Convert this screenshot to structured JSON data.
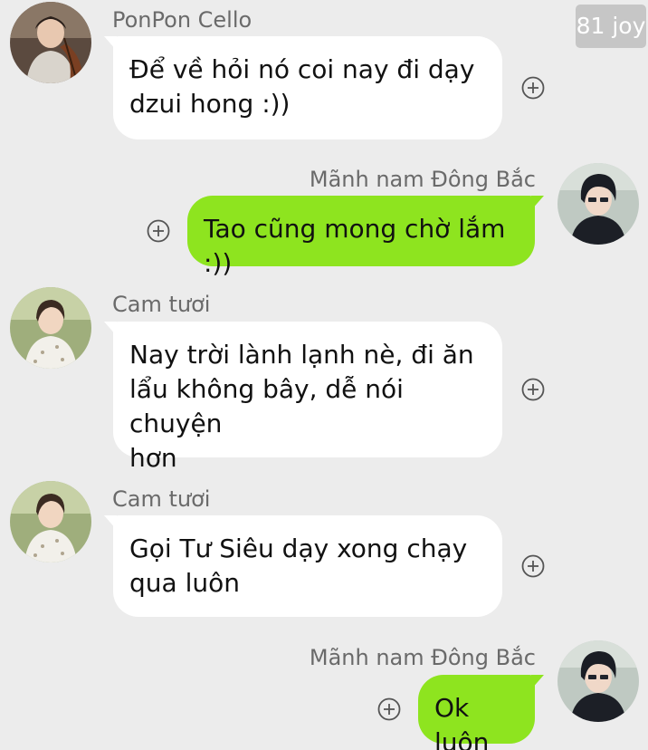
{
  "watermark": "81 joy",
  "messages": [
    {
      "sender": "PonPon Cello",
      "text": "Để về hỏi nó coi nay đi dạy\ndzui hong :))",
      "direction": "incoming",
      "avatar_icon": "cello-player-avatar"
    },
    {
      "sender": "Mãnh nam Đông Bắc",
      "text": "Tao cũng mong chờ lắm :))",
      "direction": "outgoing",
      "avatar_icon": "man-dark-hair-avatar"
    },
    {
      "sender": "Cam tươi",
      "text": "Nay trời lành lạnh nè, đi ăn\nlẩu không bây, dễ nói chuyện\nhơn",
      "direction": "incoming",
      "avatar_icon": "man-white-shirt-avatar"
    },
    {
      "sender": "Cam tươi",
      "text": "Gọi Tư Siêu dạy xong chạy\nqua luôn",
      "direction": "incoming",
      "avatar_icon": "man-white-shirt-avatar"
    },
    {
      "sender": "Mãnh nam Đông Bắc",
      "text": "Ok luôn",
      "direction": "outgoing",
      "avatar_icon": "man-dark-hair-avatar"
    }
  ],
  "colors": {
    "background": "#ececec",
    "incoming_bubble": "#ffffff",
    "outgoing_bubble": "#8ee41f",
    "sender_name": "#6a6a6a"
  },
  "icons": {
    "add_reaction": "plus-circle-icon"
  }
}
